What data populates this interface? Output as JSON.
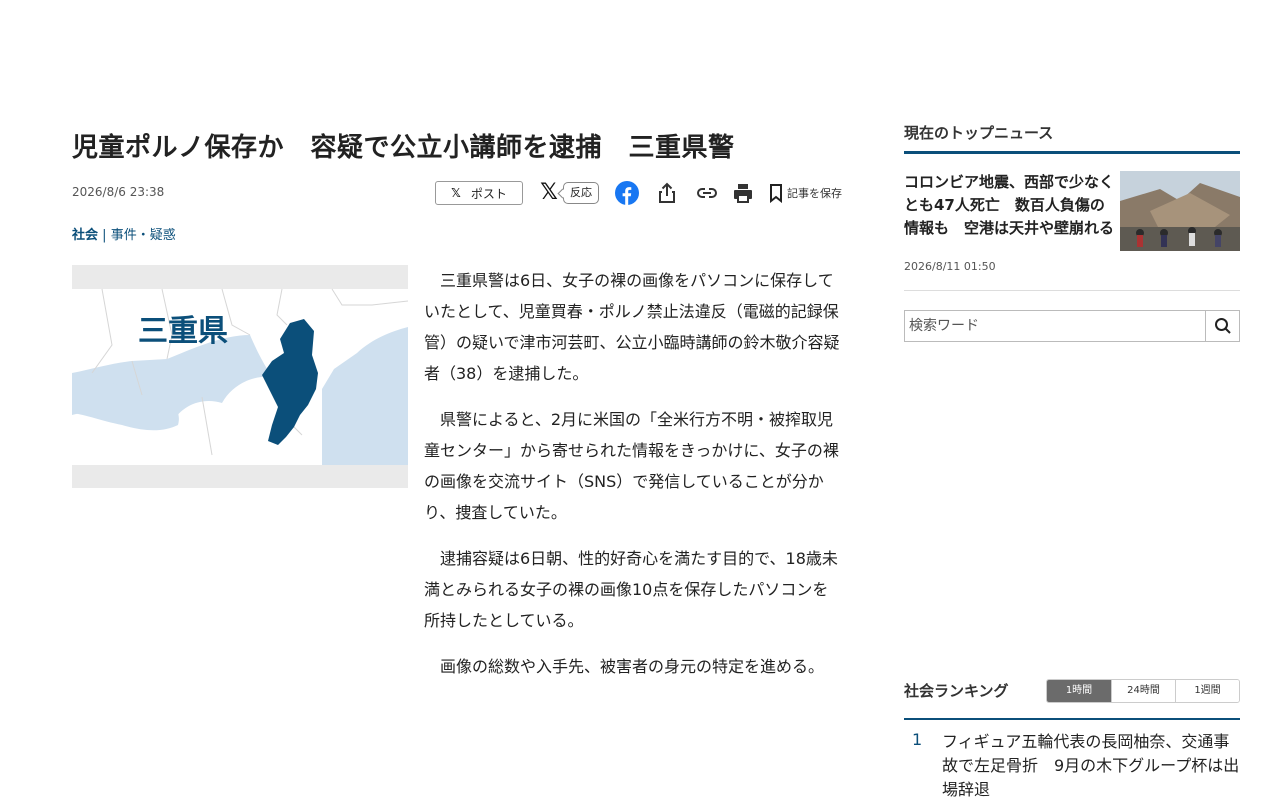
{
  "article": {
    "headline": "児童ポルノ保存か　容疑で公立小講師を逮捕　三重県警",
    "date": "2026/8/6 23:38",
    "share": {
      "post_label": "ポスト",
      "react_label": "反応",
      "save_label": "記事を保存"
    },
    "category_main": "社会",
    "category_separator": "|",
    "category_sub": "事件・疑惑",
    "map_label": "三重県",
    "paragraphs": [
      "三重県警は6日、女子の裸の画像をパソコンに保存していたとして、児童買春・ポルノ禁止法違反（電磁的記録保管）の疑いで津市河芸町、公立小臨時講師の鈴木敬介容疑者（38）を逮捕した。",
      "県警によると、2月に米国の「全米行方不明・被搾取児童センター」から寄せられた情報をきっかけに、女子の裸の画像を交流サイト（SNS）で発信していることが分かり、捜査していた。",
      "逮捕容疑は6日朝、性的好奇心を満たす目的で、18歳未満とみられる女子の裸の画像10点を保存したパソコンを所持したとしている。",
      "画像の総数や入手先、被害者の身元の特定を進める。"
    ]
  },
  "sidebar": {
    "top_news_heading": "現在のトップニュース",
    "top_news": {
      "title": "コロンビア地震、西部で少なくとも47人死亡　数百人負傷の情報も　空港は天井や壁崩れる",
      "date": "2026/8/11 01:50"
    },
    "search_placeholder": "検索ワード",
    "ranking": {
      "heading": "社会ランキング",
      "tabs": [
        "1時間",
        "24時間",
        "1週間"
      ],
      "active_tab": "1時間",
      "items": [
        {
          "rank": "1",
          "title": "フィギュア五輪代表の長岡柚奈、交通事故で左足骨折　9月の木下グループ杯は出場辞退"
        }
      ]
    }
  },
  "colors": {
    "accent": "#0b4f7a",
    "map_highlight": "#0b4f7a",
    "map_land": "#ffffff",
    "map_sea": "#cfe0ef"
  }
}
